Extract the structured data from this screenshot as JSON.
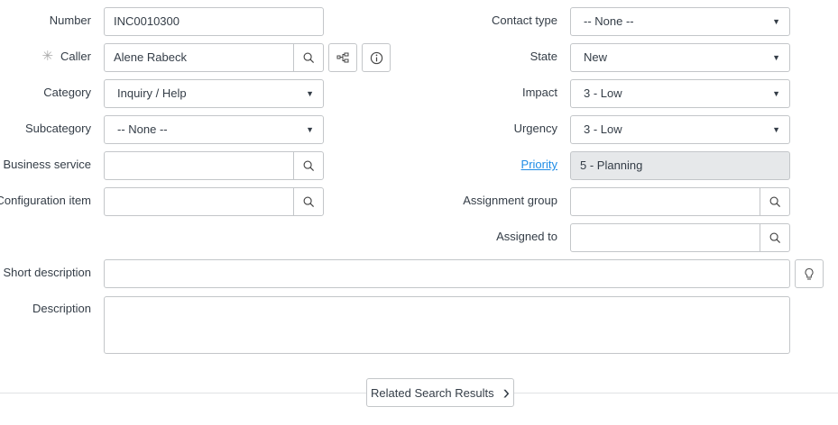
{
  "left": {
    "number": {
      "label": "Number",
      "value": "INC0010300"
    },
    "caller": {
      "label": "Caller",
      "value": "Alene Rabeck",
      "required_mark": "✳"
    },
    "category": {
      "label": "Category",
      "value": "Inquiry / Help"
    },
    "subcategory": {
      "label": "Subcategory",
      "value": "-- None --"
    },
    "business_service": {
      "label": "Business service",
      "value": ""
    },
    "configuration_item": {
      "label": "Configuration item",
      "value": ""
    }
  },
  "right": {
    "contact_type": {
      "label": "Contact type",
      "value": "-- None --"
    },
    "state": {
      "label": "State",
      "value": "New"
    },
    "impact": {
      "label": "Impact",
      "value": "3 - Low"
    },
    "urgency": {
      "label": "Urgency",
      "value": "3 - Low"
    },
    "priority": {
      "label": "Priority",
      "value": "5 - Planning"
    },
    "assignment_group": {
      "label": "Assignment group",
      "value": ""
    },
    "assigned_to": {
      "label": "Assigned to",
      "value": ""
    }
  },
  "short_description": {
    "label": "Short description",
    "value": ""
  },
  "description": {
    "label": "Description",
    "value": ""
  },
  "related_button": {
    "label": "Related Search Results",
    "icon": "›"
  },
  "colors": {
    "link": "#1f8ce6",
    "readonly": "#e6e8ea",
    "border": "#c3c6c9"
  }
}
